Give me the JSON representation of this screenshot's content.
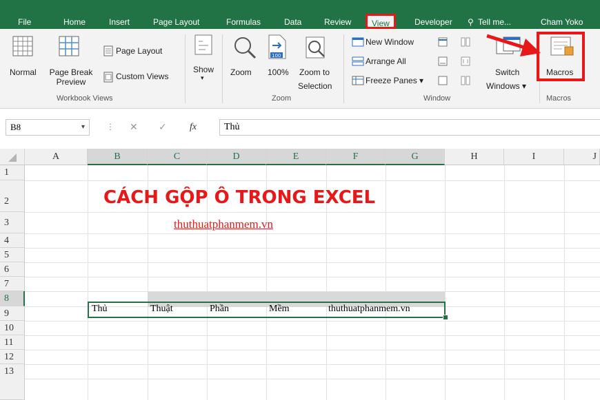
{
  "ribbon_tabs": [
    "File",
    "Home",
    "Insert",
    "Page Layout",
    "Formulas",
    "Data",
    "Review",
    "View",
    "Developer",
    "Tell me...",
    "Cham Yoko"
  ],
  "ribbon": {
    "normal": "Normal",
    "page_break_1": "Page Break",
    "page_break_2": "Preview",
    "page_layout": "Page Layout",
    "custom_views": "Custom Views",
    "show": "Show",
    "zoom": "Zoom",
    "zoom_100": "100%",
    "zoom_to_1": "Zoom to",
    "zoom_to_2": "Selection",
    "new_window": "New Window",
    "arrange_all": "Arrange All",
    "freeze_panes": "Freeze Panes",
    "switch_1": "Switch",
    "switch_2": "Windows",
    "macros": "Macros",
    "group_workbook_views": "Workbook Views",
    "group_zoom": "Zoom",
    "group_window": "Window",
    "group_macros": "Macros",
    "zoom_badge": "100"
  },
  "formula_bar": {
    "name_box": "B8",
    "fx": "fx",
    "content": "Thủ"
  },
  "columns": [
    "A",
    "B",
    "C",
    "D",
    "E",
    "F",
    "G",
    "H",
    "I",
    "J"
  ],
  "rows": [
    "1",
    "2",
    "3",
    "4",
    "5",
    "6",
    "7",
    "8",
    "9",
    "10",
    "11",
    "12",
    "13"
  ],
  "sheet": {
    "title": "CÁCH GỘP Ô TRONG EXCEL",
    "link": "thuthuatphanmem.vn",
    "row8": [
      "Thủ",
      "Thuật",
      "Phần",
      "Mềm",
      "thuthuatphanmem.vn"
    ]
  },
  "colors": {
    "excel_green": "#217346",
    "highlight_red": "#e81818"
  }
}
